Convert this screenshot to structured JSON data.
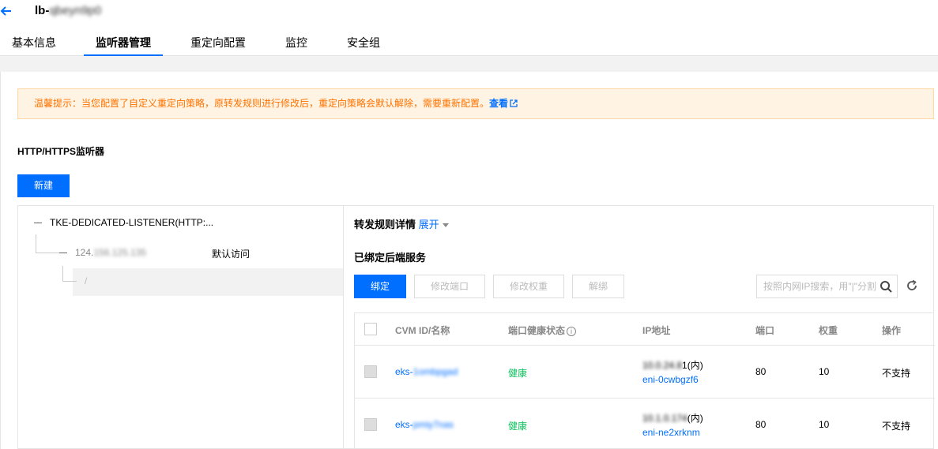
{
  "header": {
    "title_prefix": "lb-",
    "title_masked": "qbeyn9p0",
    "tabs": [
      "基本信息",
      "监听器管理",
      "重定向配置",
      "监控",
      "安全组"
    ],
    "active_tab": "监听器管理"
  },
  "notice": {
    "text": "温馨提示：当您配置了自定义重定向策略，原转发规则进行修改后，重定向策略会默认解除，需要重新配置。",
    "link": "查看"
  },
  "section_title": "HTTP/HTTPS监听器",
  "new_button": "新建",
  "tree": {
    "listener": "TKE-DEDICATED-LISTENER(HTTP:...",
    "domain_prefix": "124.",
    "domain_masked": "156.125.135",
    "default_label": "默认访问",
    "path": "/"
  },
  "detail": {
    "title": "转发规则详情",
    "expand": "展开",
    "bound_title": "已绑定后端服务",
    "buttons": {
      "bind": "绑定",
      "modify_port": "修改端口",
      "modify_weight": "修改权重",
      "unbind": "解绑"
    },
    "search_placeholder": "按照内网IP搜索，用\"|\"分割",
    "columns": [
      "CVM ID/名称",
      "端口健康状态",
      "IP地址",
      "端口",
      "权重",
      "操作"
    ],
    "rows": [
      {
        "id_prefix": "eks-",
        "id_masked": "1ombpgad",
        "health": "健康",
        "ip_masked": "10.0.24.8",
        "ip_tail": "1",
        "ip_suffix": "(内)",
        "eni": "eni-0cwbgzf6",
        "port": "80",
        "weight": "10",
        "op": "不支持"
      },
      {
        "id_prefix": "eks-",
        "id_masked": "pmiy7nas",
        "health": "健康",
        "ip_masked": "10.1.0.174",
        "ip_tail": "",
        "ip_suffix": "(内)",
        "eni": "eni-ne2xrknm",
        "port": "80",
        "weight": "10",
        "op": "不支持"
      }
    ]
  },
  "colors": {
    "primary": "#006eff",
    "warning_text": "#ff7200",
    "warning_bg": "#fff4e3",
    "healthy": "#0abf5b"
  }
}
